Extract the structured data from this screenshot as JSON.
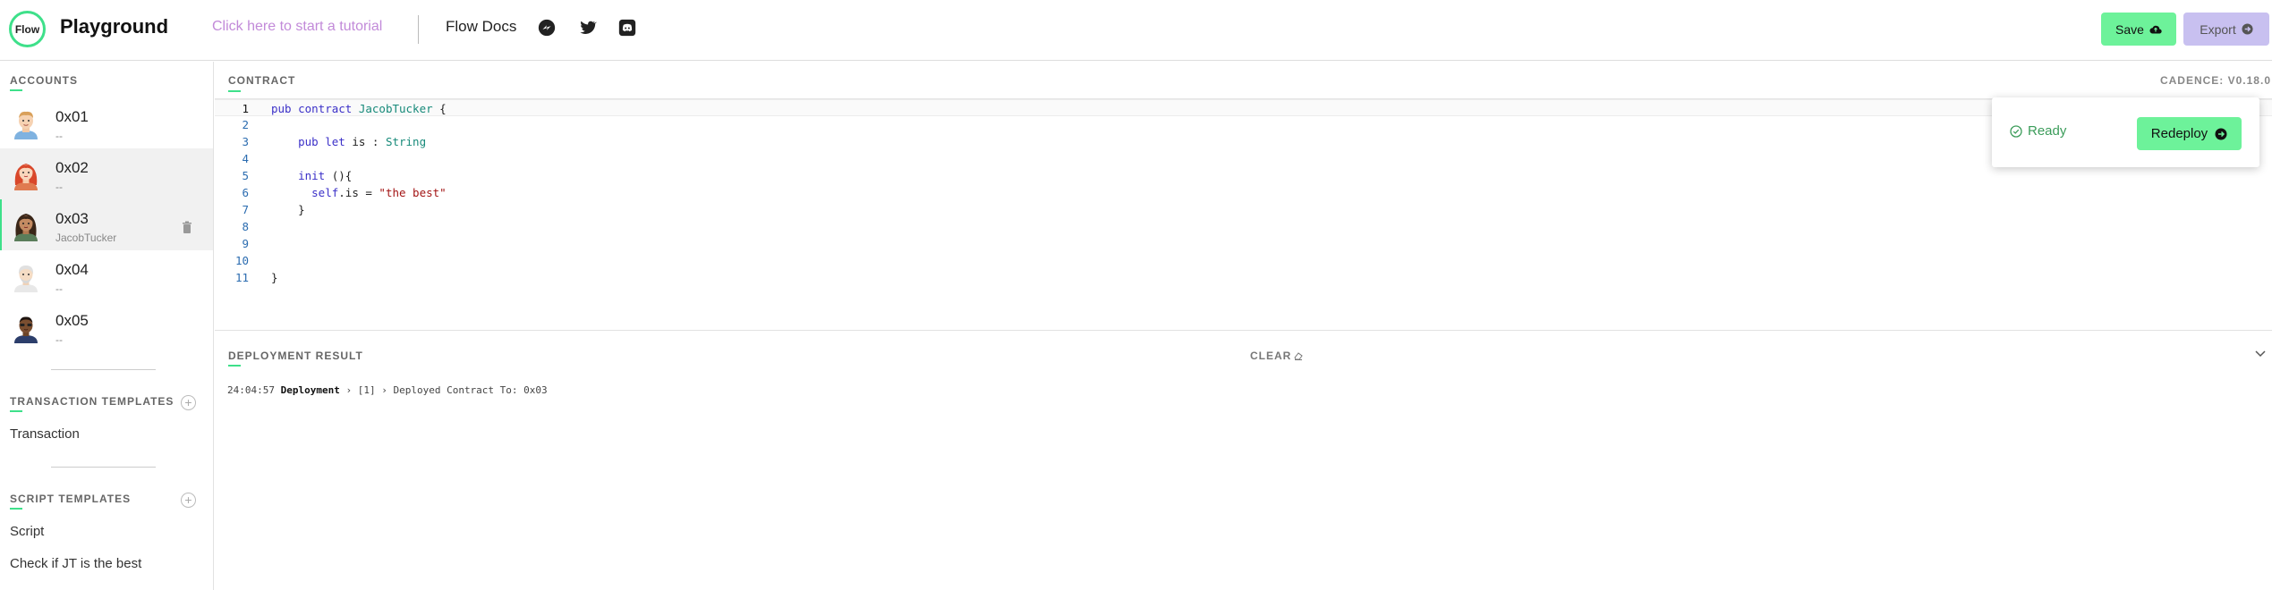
{
  "header": {
    "logo_text": "Flow",
    "title": "Playground",
    "tutorial_link": "Click here to start a tutorial",
    "docs_link": "Flow Docs",
    "social_icons": [
      "flow-forum-icon",
      "twitter-icon",
      "discord-icon"
    ],
    "save_label": "Save",
    "export_label": "Export"
  },
  "sidebar": {
    "accounts_title": "ACCOUNTS",
    "accounts": [
      {
        "address": "0x01",
        "contract": "--"
      },
      {
        "address": "0x02",
        "contract": "--"
      },
      {
        "address": "0x03",
        "contract": "JacobTucker"
      },
      {
        "address": "0x04",
        "contract": "--"
      },
      {
        "address": "0x05",
        "contract": "--"
      }
    ],
    "transaction_templates_title": "TRANSACTION TEMPLATES",
    "transaction_templates": [
      "Transaction"
    ],
    "script_templates_title": "SCRIPT TEMPLATES",
    "script_templates": [
      "Script",
      "Check if JT is the best"
    ]
  },
  "editor": {
    "section_label": "CONTRACT",
    "cadence_version": "CADENCE: V0.18.0",
    "line_numbers": [
      "1",
      "2",
      "3",
      "4",
      "5",
      "6",
      "7",
      "8",
      "9",
      "10",
      "11"
    ]
  },
  "status": {
    "ready_label": "Ready",
    "redeploy_label": "Redeploy"
  },
  "deployment": {
    "label": "DEPLOYMENT RESULT",
    "clear_label": "CLEAR",
    "log": {
      "time": "24:04:57",
      "source": "Deployment",
      "index": "[1]",
      "message": "Deployed Contract To: 0x03"
    }
  },
  "colors": {
    "accent_green": "#6df29a",
    "export_purple": "#c8c0f0",
    "tutorial_link": "#c28ad9",
    "ready_green": "#3b9c5a"
  }
}
